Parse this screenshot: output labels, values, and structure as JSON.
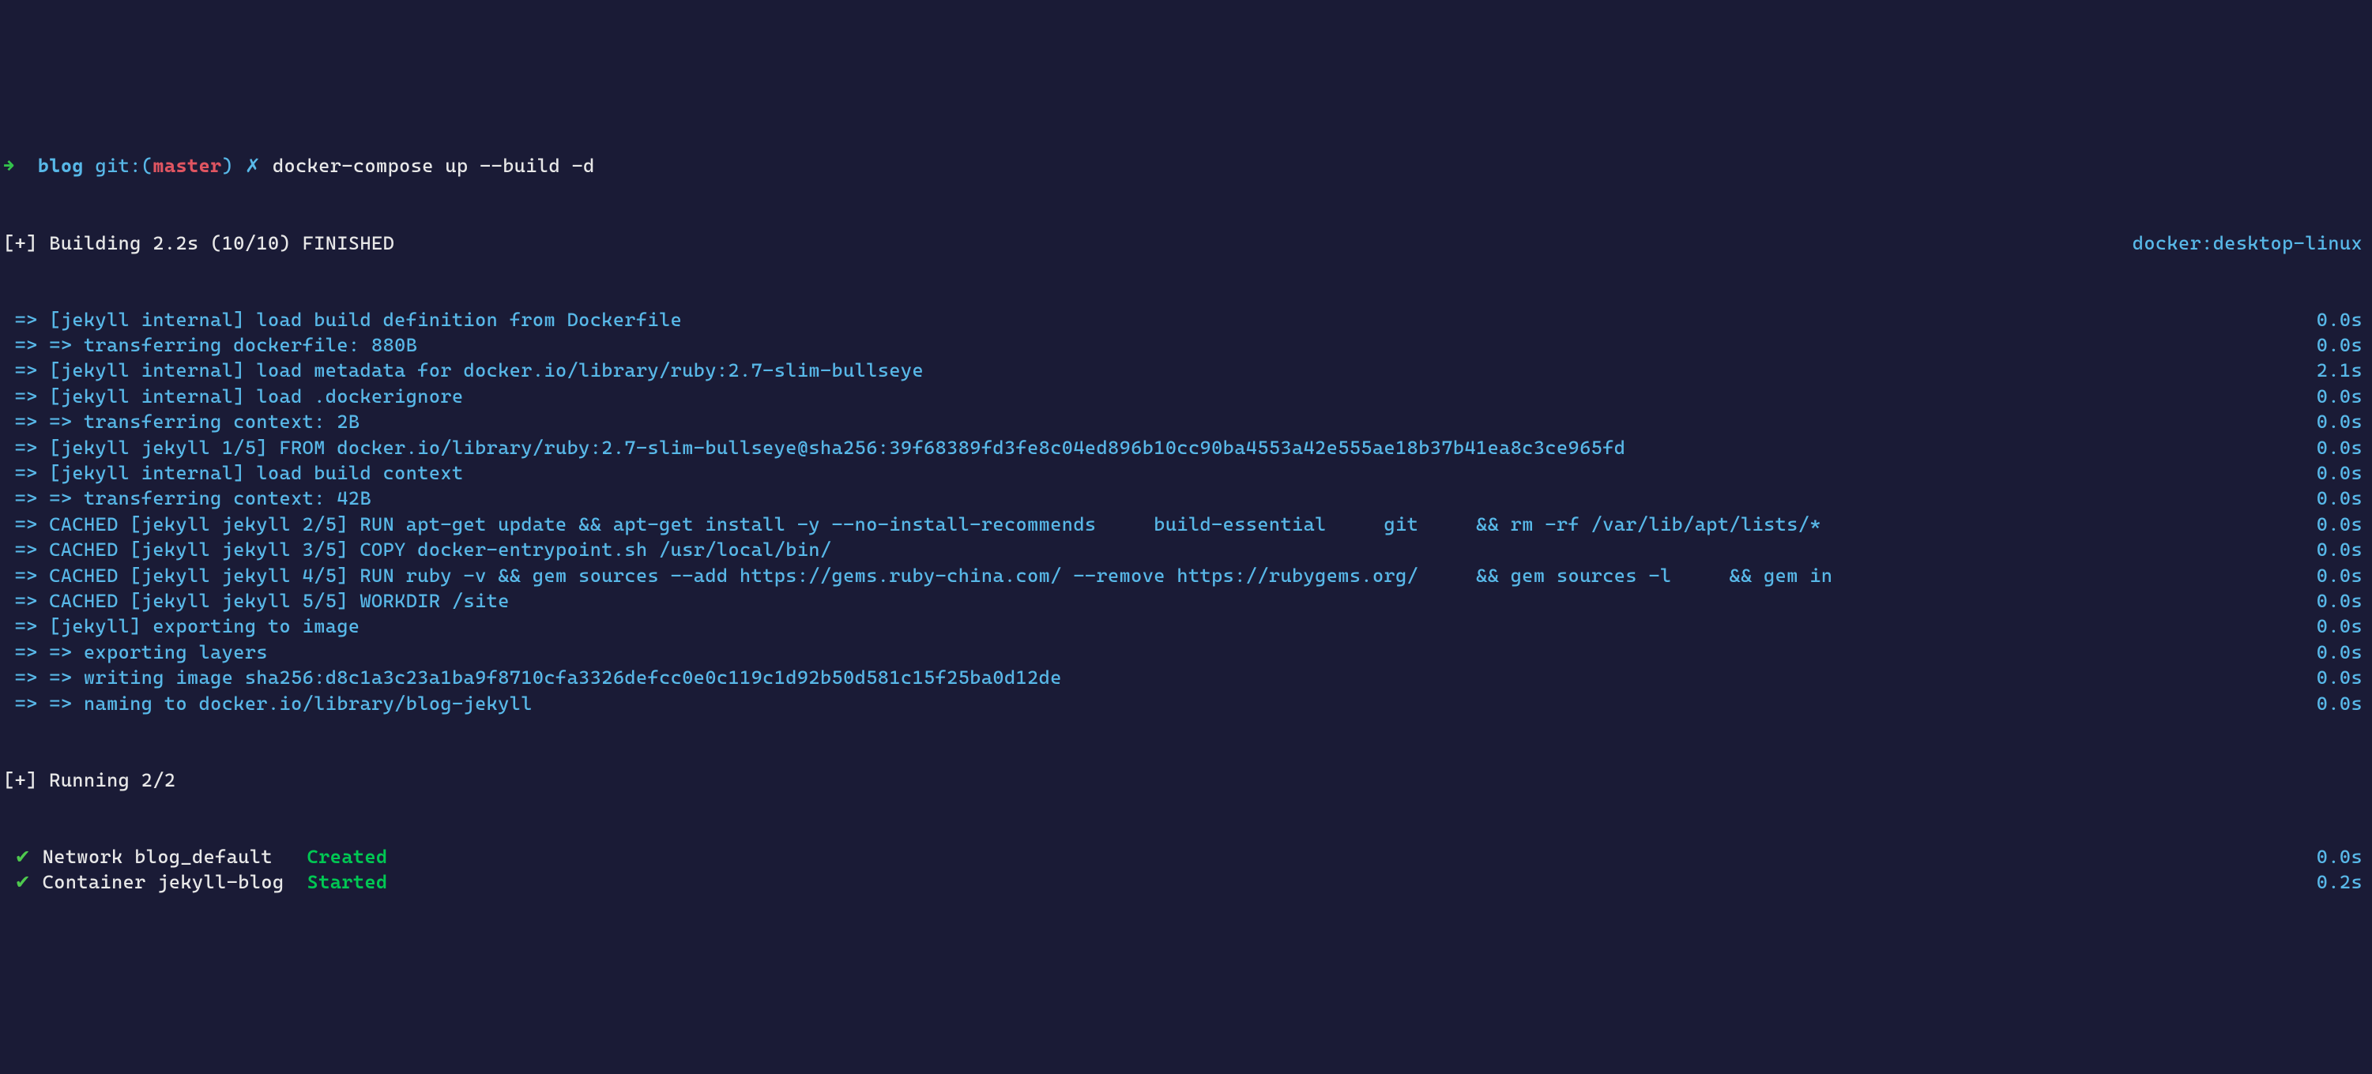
{
  "prompt": {
    "arrow": "→",
    "dir": "blog",
    "git_label": "git:(",
    "branch": "master",
    "git_close": ")",
    "dirty": "✗",
    "command": "docker-compose up --build -d"
  },
  "build_header": {
    "left": "[+] Building 2.2s (10/10) FINISHED",
    "right": "docker:desktop-linux"
  },
  "steps": [
    {
      "text": "=> [jekyll internal] load build definition from Dockerfile",
      "time": "0.0s"
    },
    {
      "text": "=> => transferring dockerfile: 880B",
      "time": "0.0s"
    },
    {
      "text": "=> [jekyll internal] load metadata for docker.io/library/ruby:2.7-slim-bullseye",
      "time": "2.1s"
    },
    {
      "text": "=> [jekyll internal] load .dockerignore",
      "time": "0.0s"
    },
    {
      "text": "=> => transferring context: 2B",
      "time": "0.0s"
    },
    {
      "text": "=> [jekyll jekyll 1/5] FROM docker.io/library/ruby:2.7-slim-bullseye@sha256:39f68389fd3fe8c04ed896b10cc90ba4553a42e555ae18b37b41ea8c3ce965fd",
      "time": "0.0s"
    },
    {
      "text": "=> [jekyll internal] load build context",
      "time": "0.0s"
    },
    {
      "text": "=> => transferring context: 42B",
      "time": "0.0s"
    },
    {
      "text": "=> CACHED [jekyll jekyll 2/5] RUN apt-get update && apt-get install -y --no-install-recommends     build-essential     git     && rm -rf /var/lib/apt/lists/*",
      "time": "0.0s"
    },
    {
      "text": "=> CACHED [jekyll jekyll 3/5] COPY docker-entrypoint.sh /usr/local/bin/",
      "time": "0.0s"
    },
    {
      "text": "=> CACHED [jekyll jekyll 4/5] RUN ruby -v && gem sources --add https://gems.ruby-china.com/ --remove https://rubygems.org/     && gem sources -l     && gem in",
      "time": "0.0s"
    },
    {
      "text": "=> CACHED [jekyll jekyll 5/5] WORKDIR /site",
      "time": "0.0s"
    },
    {
      "text": "=> [jekyll] exporting to image",
      "time": "0.0s"
    },
    {
      "text": "=> => exporting layers",
      "time": "0.0s"
    },
    {
      "text": "=> => writing image sha256:d8c1a3c23a1ba9f8710cfa3326defcc0e0c119c1d92b50d581c15f25ba0d12de",
      "time": "0.0s"
    },
    {
      "text": "=> => naming to docker.io/library/blog-jekyll",
      "time": "0.0s"
    }
  ],
  "running_header": "[+] Running 2/2",
  "results": [
    {
      "check": "✔",
      "name": "Network blog_default",
      "status": "Created",
      "time": "0.0s"
    },
    {
      "check": "✔",
      "name": "Container jekyll-blog",
      "status": "Started",
      "time": "0.2s"
    }
  ]
}
